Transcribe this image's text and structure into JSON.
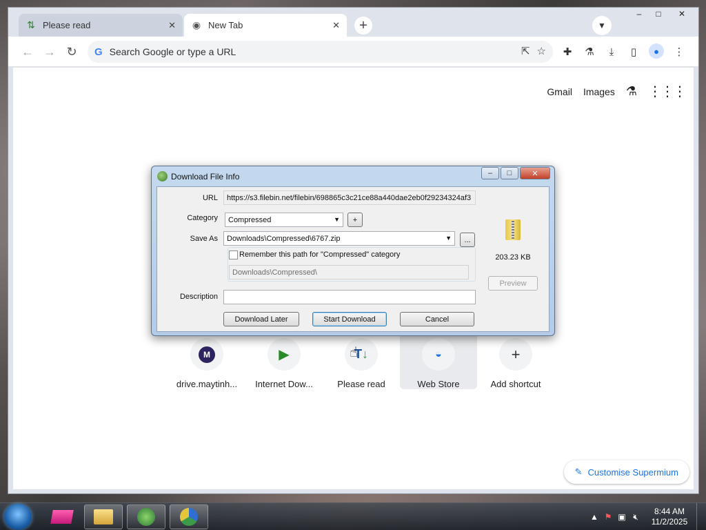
{
  "browser": {
    "tabs": [
      {
        "label": "Please read",
        "icon": "idm-arrows-icon",
        "close": "✕"
      },
      {
        "label": "New Tab",
        "icon": "chrome-icon",
        "close": "✕"
      }
    ],
    "new_tab_symbol": "+",
    "omnibox_placeholder": "Search Google or type a URL",
    "google_g": "G",
    "window_controls": {
      "minimize": "–",
      "maximize": "□",
      "close": "✕"
    }
  },
  "ntp": {
    "top_links": {
      "gmail": "Gmail",
      "images": "Images"
    },
    "shortcuts": [
      {
        "label": "drive.maytinh...",
        "badge": "M"
      },
      {
        "label": "Internet Dow..."
      },
      {
        "label": "Please read",
        "badge": "T"
      },
      {
        "label": "Web Store"
      },
      {
        "label": "Add shortcut",
        "badge": "+"
      }
    ],
    "customise_label": "Customise Supermium"
  },
  "dialog": {
    "title": "Download File Info",
    "url_label": "URL",
    "url_value": "https://s3.filebin.net/filebin/698865c3c21ce88a440dae2eb0f29234324af3",
    "category_label": "Category",
    "category_value": "Compressed",
    "add_category": "+",
    "save_as_label": "Save As",
    "save_as_value": "Downloads\\Compressed\\6767.zip",
    "browse": "...",
    "remember_label": "Remember this path for \"Compressed\" category",
    "remembered_path": "Downloads\\Compressed\\",
    "description_label": "Description",
    "description_value": "",
    "file_size": "203.23  KB",
    "preview": "Preview",
    "download_later": "Download Later",
    "start_download": "Start Download",
    "cancel": "Cancel"
  },
  "taskbar": {
    "time": "8:44 AM",
    "date": "11/2/2025"
  }
}
